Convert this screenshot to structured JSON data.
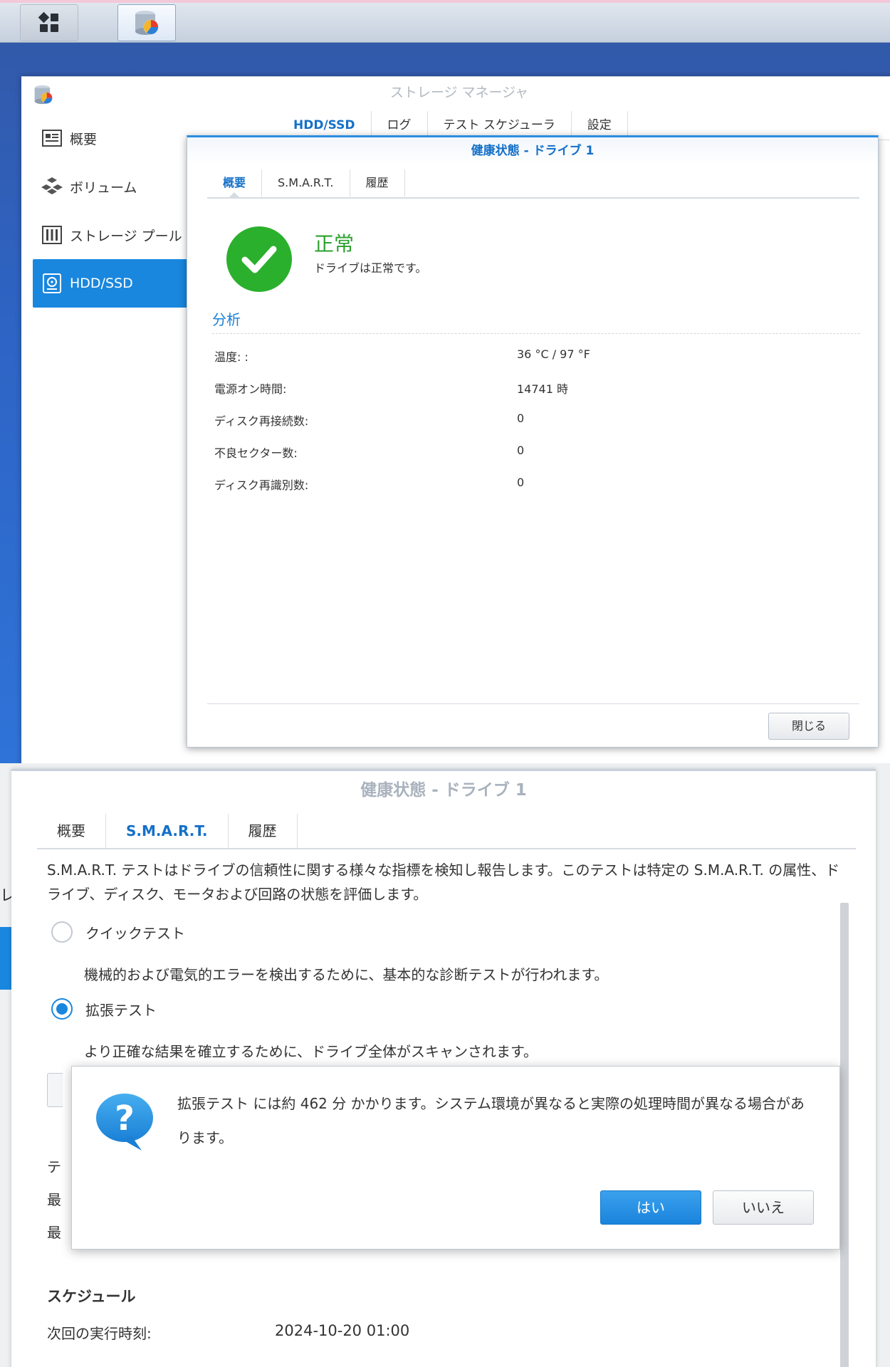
{
  "top": {
    "window_title": "ストレージ マネージャ",
    "sidebar": [
      {
        "label": "概要",
        "icon": "overview-icon"
      },
      {
        "label": "ボリューム",
        "icon": "volume-icon"
      },
      {
        "label": "ストレージ プール",
        "icon": "storage-pool-icon"
      },
      {
        "label": "HDD/SSD",
        "icon": "hdd-icon",
        "active": true
      }
    ],
    "tabs": [
      "HDD/SSD",
      "ログ",
      "テスト スケジューラ",
      "設定"
    ],
    "dialog": {
      "title": "健康状態 - ドライブ 1",
      "tabs": [
        "概要",
        "S.M.A.R.T.",
        "履歴"
      ],
      "status_title": "正常",
      "status_desc": "ドライブは正常です。",
      "analysis_heading": "分析",
      "rows": [
        {
          "label": "温度: :",
          "value": "36 °C / 97 °F"
        },
        {
          "label": "電源オン時間:",
          "value": "14741 時"
        },
        {
          "label": "ディスク再接続数:",
          "value": "0"
        },
        {
          "label": "不良セクター数:",
          "value": "0"
        },
        {
          "label": "ディスク再識別数:",
          "value": "0"
        }
      ],
      "close_label": "閉じる"
    }
  },
  "bottom": {
    "left_char": "レ",
    "dialog": {
      "title": "健康状態 - ドライブ 1",
      "tabs": [
        "概要",
        "S.M.A.R.T.",
        "履歴"
      ],
      "description": "S.M.A.R.T. テストはドライブの信頼性に関する様々な指標を検知し報告します。このテストは特定の S.M.A.R.T. の属性、ドライブ、ディスク、モータおよび回路の状態を評価します。",
      "quick_test": {
        "label": "クイックテスト",
        "desc": "機械的および電気的エラーを検出するために、基本的な診断テストが行われます。",
        "selected": false
      },
      "extended_test": {
        "label": "拡張テスト",
        "desc": "より正確な結果を確立するために、ドライブ全体がスキャンされます。",
        "selected": true
      },
      "peek_chars": [
        "テ",
        "最",
        "最"
      ],
      "schedule_heading": "スケジュール",
      "next_run_label": "次回の実行時刻:",
      "next_run_value": "2024-10-20 01:00"
    },
    "confirm": {
      "message": "拡張テスト には約 462 分 かかります。システム環境が異なると実際の処理時間が異なる場合があります。",
      "yes": "はい",
      "no": "いいえ"
    }
  },
  "colors": {
    "accent": "#1a87de",
    "ok_green": "#2bb02e",
    "link_blue": "#1570c8"
  }
}
